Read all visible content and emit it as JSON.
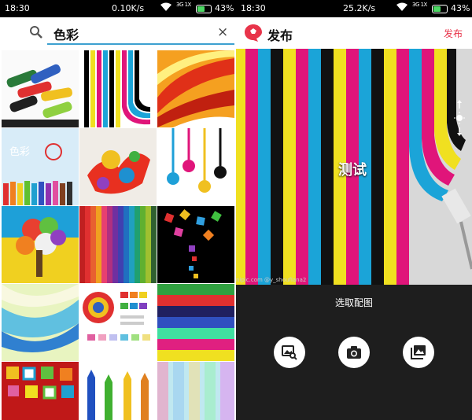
{
  "status_left": {
    "time": "18:30",
    "speed": "0.10K/s",
    "signal": "3G 1X",
    "battery": "43%"
  },
  "status_right": {
    "time": "18:30",
    "speed": "25.2K/s",
    "signal": "3G 1X",
    "battery": "43%"
  },
  "search": {
    "query": "色彩",
    "clear_icon": "×"
  },
  "publish": {
    "title": "发布",
    "action": "发布",
    "accent": "#e8344a"
  },
  "preview": {
    "overlay_text": "测试",
    "watermark": "nipic.com   @y_shoufiana2"
  },
  "thumb_text": {
    "tile4": "色彩"
  },
  "picker": {
    "title": "选取配图",
    "buttons": [
      {
        "name": "search-image-button",
        "icon": "image-search-icon"
      },
      {
        "name": "camera-button",
        "icon": "camera-icon"
      },
      {
        "name": "gallery-button",
        "icon": "gallery-icon"
      }
    ]
  }
}
